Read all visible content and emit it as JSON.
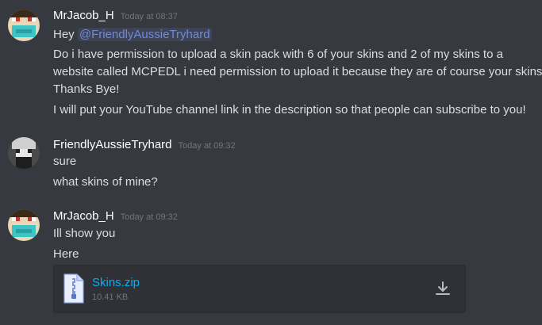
{
  "messages": [
    {
      "author": "MrJacob_H",
      "timestamp": "Today at 08:37",
      "lines": {
        "greeting": "Hey ",
        "mention": "@FriendlyAussieTryhard",
        "l2": "Do i have permission to upload a skin pack with 6 of your skins and 2 of my skins to a",
        "l3": "website called MCPEDL i need permission to upload it because they are of course your skins!",
        "l4": "Thanks Bye!",
        "l5": "I will put your YouTube channel link in the description so that people can subscribe to you!"
      }
    },
    {
      "author": "FriendlyAussieTryhard",
      "timestamp": "Today at 09:32",
      "lines": {
        "l1": "sure",
        "l2": "what skins of mine?"
      }
    },
    {
      "author": "MrJacob_H",
      "timestamp": "Today at 09:32",
      "lines": {
        "l1": "Ill show you",
        "l2": "Here"
      },
      "attachment": {
        "name": "Skins.zip",
        "size": "10.41 KB"
      }
    }
  ],
  "icons": {
    "file": "file-zip-icon",
    "download": "download-icon"
  },
  "colors": {
    "background": "#36393f",
    "mention": "#7289da",
    "link": "#00b0f4",
    "muted": "#72767d"
  }
}
